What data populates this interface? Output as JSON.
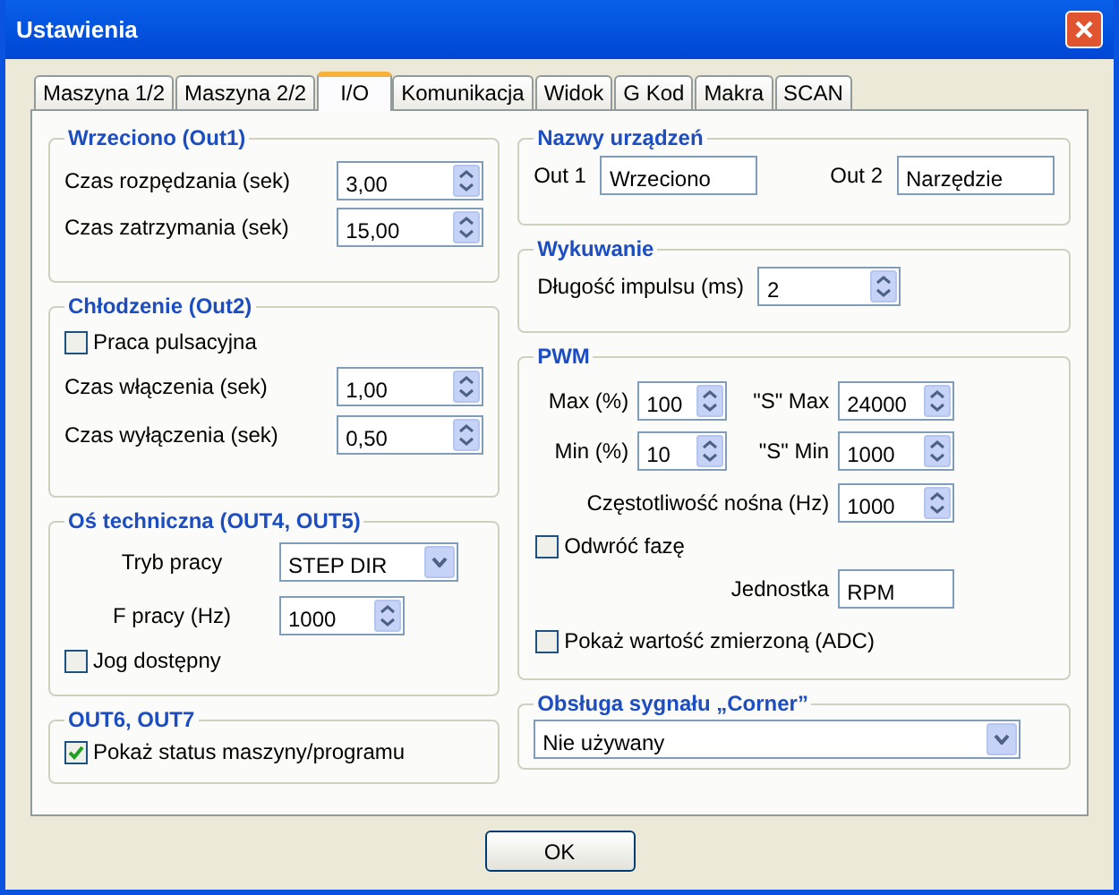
{
  "window": {
    "title": "Ustawienia"
  },
  "tabs": [
    {
      "label": "Maszyna 1/2",
      "selected": false
    },
    {
      "label": "Maszyna 2/2",
      "selected": false
    },
    {
      "label": "I/O",
      "selected": true
    },
    {
      "label": "Komunikacja",
      "selected": false
    },
    {
      "label": "Widok",
      "selected": false
    },
    {
      "label": "G Kod",
      "selected": false
    },
    {
      "label": "Makra",
      "selected": false
    },
    {
      "label": "SCAN",
      "selected": false
    }
  ],
  "spindle": {
    "title": "Wrzeciono (Out1)",
    "rows": [
      {
        "label": "Czas rozpędzania (sek)",
        "value": "3,00"
      },
      {
        "label": "Czas zatrzymania (sek)",
        "value": "15,00"
      }
    ]
  },
  "cooling": {
    "title": "Chłodzenie (Out2)",
    "pulse": {
      "label": "Praca pulsacyjna",
      "checked": false
    },
    "rows": [
      {
        "label": "Czas włączenia (sek)",
        "value": "1,00"
      },
      {
        "label": "Czas wyłączenia (sek)",
        "value": "0,50"
      }
    ]
  },
  "aux_axis": {
    "title": "Oś techniczna (OUT4, OUT5)",
    "mode": {
      "label": "Tryb pracy",
      "value": "STEP DIR"
    },
    "freq": {
      "label": "F pracy (Hz)",
      "value": "1000"
    },
    "jog": {
      "label": "Jog dostępny",
      "checked": false
    }
  },
  "out67": {
    "title": "OUT6, OUT7",
    "status": {
      "label": "Pokaż status maszyny/programu",
      "checked": true
    }
  },
  "device_names": {
    "title": "Nazwy urządzeń",
    "fields": [
      {
        "label": "Out 1",
        "value": "Wrzeciono"
      },
      {
        "label": "Out 2",
        "value": "Narzędzie"
      }
    ]
  },
  "forging": {
    "title": "Wykuwanie",
    "pulse": {
      "label": "Długość impulsu (ms)",
      "value": "2"
    }
  },
  "pwm": {
    "title": "PWM",
    "rows": [
      [
        {
          "label": "Max (%)",
          "value": "100"
        },
        {
          "label": "\"S\" Max",
          "value": "24000"
        }
      ],
      [
        {
          "label": "Min (%)",
          "value": "10"
        },
        {
          "label": "\"S\" Min",
          "value": "1000"
        }
      ]
    ],
    "carrier": {
      "label": "Częstotliwość nośna (Hz)",
      "value": "1000"
    },
    "invert": {
      "label": "Odwróć fazę",
      "checked": false
    },
    "unit": {
      "label": "Jednostka",
      "value": "RPM"
    },
    "adc": {
      "label": "Pokaż wartość zmierzoną (ADC)",
      "checked": false
    }
  },
  "corner": {
    "title": "Obsługa sygnału „Corner”",
    "value": "Nie używany"
  },
  "ok_button": "OK"
}
